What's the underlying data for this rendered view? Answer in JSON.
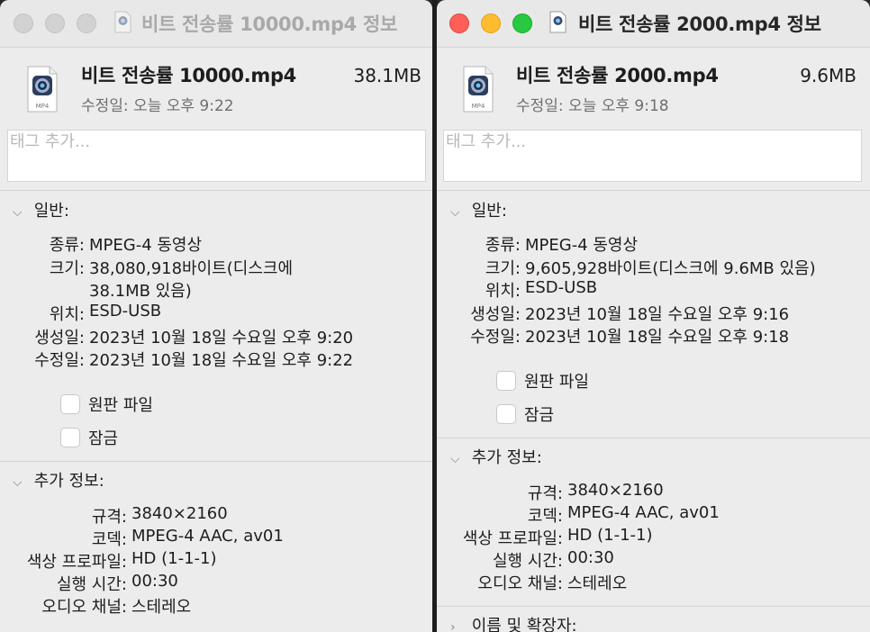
{
  "left": {
    "window_title": "비트 전송률 10000.mp4 정보",
    "file": {
      "name": "비트 전송률 10000.mp4",
      "size": "38.1MB",
      "modified": "수정일: 오늘 오후 9:22",
      "badge": "MP4"
    },
    "tags_placeholder": "태그 추가...",
    "general": {
      "title": "일반:",
      "rows": [
        {
          "label": "종류:",
          "value": "MPEG-4 동영상"
        },
        {
          "label": "크기:",
          "value": "38,080,918바이트(디스크에",
          "value2": "38.1MB 있음)"
        },
        {
          "label": "위치:",
          "value": "ESD-USB"
        },
        {
          "label": "생성일:",
          "value": "2023년 10월 18일 수요일 오후 9:20"
        },
        {
          "label": "수정일:",
          "value": "2023년 10월 18일 수요일 오후 9:22"
        }
      ],
      "checkboxes": [
        {
          "label": "원판 파일"
        },
        {
          "label": "잠금"
        }
      ]
    },
    "more_info": {
      "title": "추가 정보:",
      "rows": [
        {
          "label": "규격:",
          "value": "3840×2160"
        },
        {
          "label": "코덱:",
          "value": "MPEG-4 AAC, av01"
        },
        {
          "label": "색상 프로파일:",
          "value": "HD (1-1-1)"
        },
        {
          "label": "실행 시간:",
          "value": "00:30"
        },
        {
          "label": "오디오 채널:",
          "value": "스테레오"
        }
      ]
    }
  },
  "right": {
    "window_title": "비트 전송률 2000.mp4 정보",
    "file": {
      "name": "비트 전송률 2000.mp4",
      "size": "9.6MB",
      "modified": "수정일: 오늘 오후 9:18",
      "badge": "MP4"
    },
    "tags_placeholder": "태그 추가...",
    "general": {
      "title": "일반:",
      "rows": [
        {
          "label": "종류:",
          "value": "MPEG-4 동영상"
        },
        {
          "label": "크기:",
          "value": "9,605,928바이트(디스크에 9.6MB 있음)"
        },
        {
          "label": "위치:",
          "value": "ESD-USB"
        },
        {
          "label": "생성일:",
          "value": "2023년 10월 18일 수요일 오후 9:16"
        },
        {
          "label": "수정일:",
          "value": "2023년 10월 18일 수요일 오후 9:18"
        }
      ],
      "checkboxes": [
        {
          "label": "원판 파일"
        },
        {
          "label": "잠금"
        }
      ]
    },
    "more_info": {
      "title": "추가 정보:",
      "rows": [
        {
          "label": "규격:",
          "value": "3840×2160"
        },
        {
          "label": "코덱:",
          "value": "MPEG-4 AAC, av01"
        },
        {
          "label": "색상 프로파일:",
          "value": "HD (1-1-1)"
        },
        {
          "label": "실행 시간:",
          "value": "00:30"
        },
        {
          "label": "오디오 채널:",
          "value": "스테레오"
        }
      ]
    },
    "name_ext": {
      "title": "이름 및 확장자:"
    }
  },
  "icons": {
    "file": "quicktime-movie-icon",
    "chevron_open": "chevron-down-icon",
    "chevron_closed": "chevron-right-icon"
  }
}
